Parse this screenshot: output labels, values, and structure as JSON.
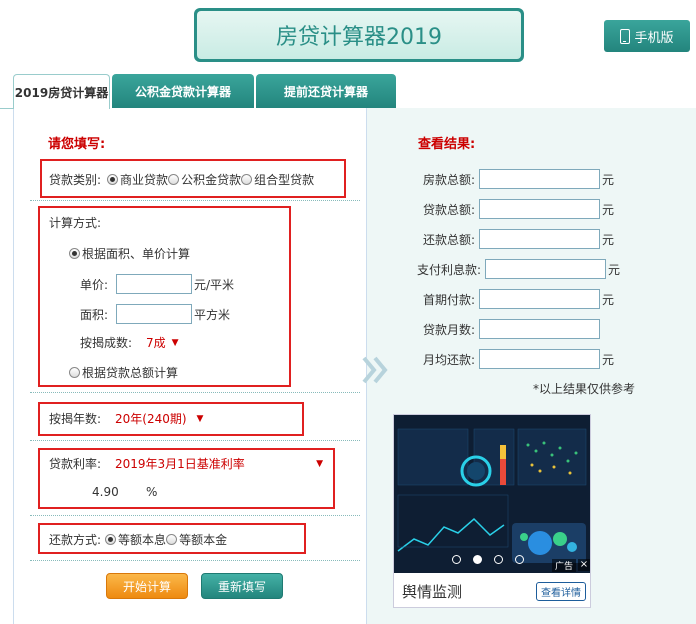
{
  "header": {
    "title": "房贷计算器2019",
    "mobile_label": "手机版"
  },
  "tabs": [
    {
      "label": "2019房贷计算器",
      "active": true
    },
    {
      "label": "公积金贷款计算器",
      "active": false
    },
    {
      "label": "提前还贷计算器",
      "active": false
    }
  ],
  "form": {
    "heading": "请您填写:",
    "loan_type": {
      "label": "贷款类别:",
      "options": [
        "商业贷款",
        "公积金贷款",
        "组合型贷款"
      ],
      "selected": "商业贷款"
    },
    "calc_method": {
      "label": "计算方式:",
      "option_area": "根据面积、单价计算",
      "option_total": "根据贷款总额计算",
      "selected": "根据面积、单价计算",
      "price_label": "单价:",
      "price_value": "",
      "price_unit": "元/平米",
      "area_label": "面积:",
      "area_value": "",
      "area_unit": "平方米",
      "ratio_label": "按揭成数:",
      "ratio_value": "7成"
    },
    "years": {
      "label": "按揭年数:",
      "value": "20年(240期)"
    },
    "rate": {
      "label": "贷款利率:",
      "value": "2019年3月1日基准利率",
      "number": "4.90",
      "unit": "%"
    },
    "repay": {
      "label": "还款方式:",
      "options": [
        "等额本息",
        "等额本金"
      ],
      "selected": "等额本息"
    },
    "start_button": "开始计算",
    "reset_button": "重新填写"
  },
  "results": {
    "heading": "查看结果:",
    "rows": [
      {
        "label": "房款总额:",
        "value": "",
        "unit": "元"
      },
      {
        "label": "贷款总额:",
        "value": "",
        "unit": "元"
      },
      {
        "label": "还款总额:",
        "value": "",
        "unit": "元"
      },
      {
        "label": "支付利息款:",
        "value": "",
        "unit": "元"
      },
      {
        "label": "首期付款:",
        "value": "",
        "unit": "元"
      },
      {
        "label": "贷款月数:",
        "value": "",
        "unit": ""
      },
      {
        "label": "月均还款:",
        "value": "",
        "unit": "元"
      }
    ],
    "note": "*以上结果仅供参考"
  },
  "ad": {
    "title": "舆情监测",
    "detail_label": "查看详情",
    "badge": "广告",
    "close_glyph": "×",
    "slides_total": 4,
    "slide_active": 2
  },
  "colors": {
    "brand": "#2a8f87",
    "accent_red": "#cc0000",
    "border_red": "#e02020",
    "button_orange": "#ee8a10"
  }
}
